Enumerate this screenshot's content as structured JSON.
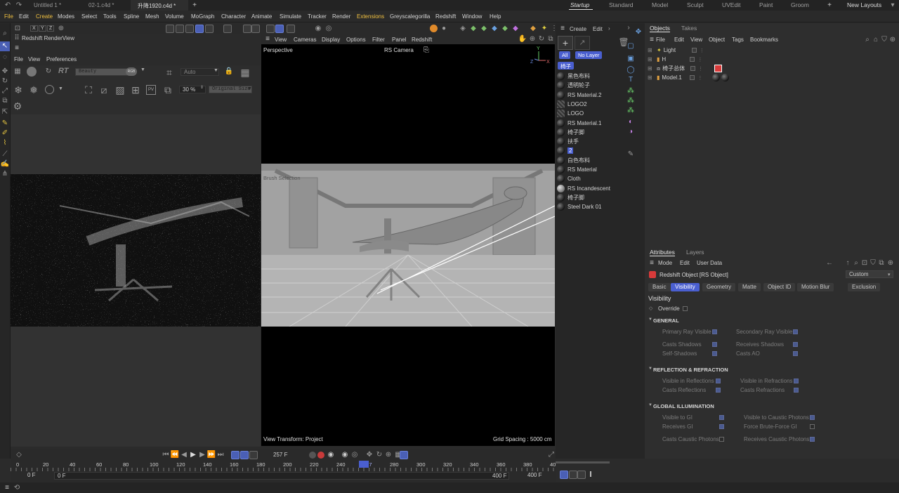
{
  "tabs": [
    "Untitled 1 *",
    "02-1.c4d *",
    "升降1920.c4d *"
  ],
  "layouts": [
    "Startup",
    "Standard",
    "Model",
    "Sculpt",
    "UVEdit",
    "Paint",
    "Groom"
  ],
  "new_layouts": "New Layouts",
  "menu": [
    "File",
    "Edit",
    "Create",
    "Modes",
    "Select",
    "Tools",
    "Spline",
    "Mesh",
    "Volume",
    "MoGraph",
    "Character",
    "Animate",
    "Simulate",
    "Tracker",
    "Render",
    "Extensions",
    "Greyscalegorilla",
    "Redshift",
    "Window",
    "Help"
  ],
  "toolbar_axes": [
    "X",
    "Y",
    "Z"
  ],
  "renderview": {
    "title": "Redshift RenderView",
    "menu": [
      "File",
      "View",
      "Preferences"
    ],
    "rt": "RT",
    "aov": "Beauty",
    "rgb": "RGB",
    "auto": "Auto",
    "zoom": "30 %",
    "size": "Original Size"
  },
  "viewport": {
    "menu": [
      "View",
      "Cameras",
      "Display",
      "Options",
      "Filter",
      "Panel",
      "Redshift"
    ],
    "name": "Perspective",
    "camera": "RS Camera",
    "brush": "Brush Selection",
    "transform": "View Transform: Project",
    "grid": "Grid Spacing : 5000 cm",
    "axis_y": "Y",
    "axis_z": "Z",
    "axis_x": "X"
  },
  "materials": {
    "menu": [
      "Create",
      "Edit"
    ],
    "filters": [
      "All",
      "No Layer"
    ],
    "tag": "椅子",
    "items": [
      {
        "name": "黑色布料",
        "kind": "ball"
      },
      {
        "name": "透明轮子",
        "kind": "ball"
      },
      {
        "name": "RS Material.2",
        "kind": "ball"
      },
      {
        "name": "LOGO2",
        "kind": "tex"
      },
      {
        "name": "LOGO",
        "kind": "tex"
      },
      {
        "name": "RS Material.1",
        "kind": "ball"
      },
      {
        "name": "椅子脚",
        "kind": "ball"
      },
      {
        "name": "扶手",
        "kind": "ball"
      },
      {
        "name": "2",
        "kind": "ball"
      },
      {
        "name": "白色布料",
        "kind": "ball"
      },
      {
        "name": "RS Material",
        "kind": "ball"
      },
      {
        "name": "Cloth",
        "kind": "ball"
      },
      {
        "name": "RS Incandescent",
        "kind": "light"
      },
      {
        "name": "椅子脚",
        "kind": "ball"
      },
      {
        "name": "Steel Dark 01",
        "kind": "ball"
      }
    ]
  },
  "objects": {
    "tabs": [
      "Objects",
      "Takes"
    ],
    "menu": [
      "File",
      "Edit",
      "View",
      "Object",
      "Tags",
      "Bookmarks"
    ],
    "items": [
      "Light",
      "H",
      "椅子总体",
      "Model.1"
    ]
  },
  "attributes": {
    "tabs": [
      "Attributes",
      "Layers"
    ],
    "menu": [
      "Mode",
      "Edit",
      "User Data"
    ],
    "object": "Redshift Object [RS Object]",
    "preset": "Custom",
    "subtabs": [
      "Basic",
      "Visibility",
      "Geometry",
      "Matte",
      "Object ID",
      "Motion Blur",
      "Exclusion"
    ],
    "heading": "Visibility",
    "override": "Override",
    "sections": {
      "general": "GENERAL",
      "reflection": "REFLECTION & REFRACTION",
      "gi": "GLOBAL ILLUMINATION"
    },
    "props": {
      "primary": "Primary Ray Visible",
      "secondary": "Secondary Ray Visible",
      "casts_shadows": "Casts Shadows",
      "receives_shadows": "Receives Shadows",
      "self_shadows": "Self-Shadows",
      "casts_ao": "Casts AO",
      "vis_refl": "Visible in Reflections",
      "vis_refr": "Visible in Refractions",
      "casts_refl": "Casts Reflections",
      "casts_refr": "Casts Refractions",
      "vis_gi": "Visible to GI",
      "vis_caustic": "Visible to Caustic Photons",
      "receives_gi": "Receives GI",
      "force_bf": "Force Brute-Force GI",
      "casts_caustic": "Casts Caustic Photons",
      "receives_caustic": "Receives Caustic Photons"
    }
  },
  "timeline": {
    "current": "257 F",
    "ticks": [
      "0",
      "20",
      "40",
      "60",
      "80",
      "100",
      "120",
      "140",
      "160",
      "180",
      "200",
      "220",
      "240",
      "257",
      "280",
      "300",
      "320",
      "340",
      "360",
      "380",
      "40"
    ],
    "start": "0 F",
    "start2": "0 F",
    "end": "400 F",
    "end2": "400 F"
  }
}
